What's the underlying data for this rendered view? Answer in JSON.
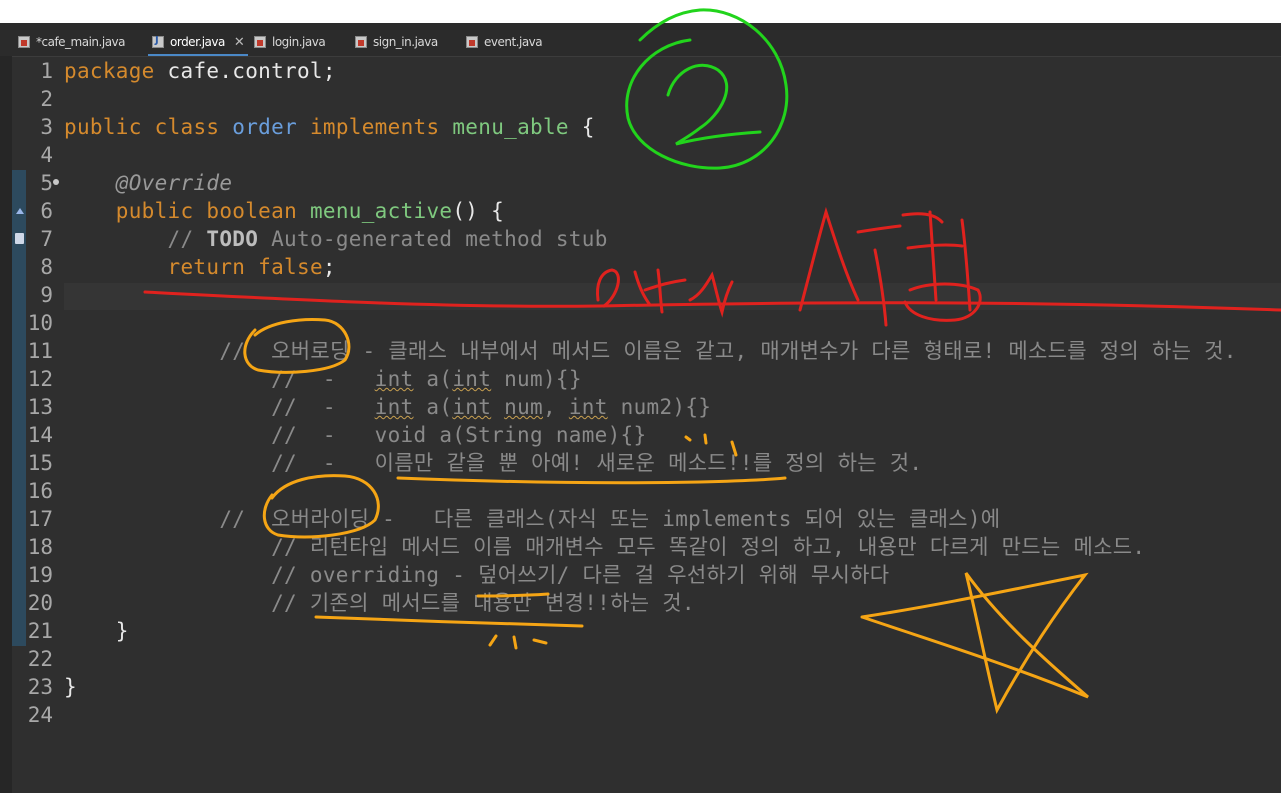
{
  "tabs": [
    {
      "label": "*cafe_main.java",
      "icon": "java-error-file-icon"
    },
    {
      "label": "order.java",
      "icon": "java-file-icon",
      "active": true
    },
    {
      "label": "login.java",
      "icon": "java-error-file-icon"
    },
    {
      "label": "sign_in.java",
      "icon": "java-error-file-icon"
    },
    {
      "label": "event.java",
      "icon": "java-error-file-icon"
    }
  ],
  "lines": [
    {
      "n": "1",
      "segments": [
        [
          "kw",
          "package"
        ],
        [
          "pl",
          " cafe.control;"
        ]
      ]
    },
    {
      "n": "2",
      "segments": []
    },
    {
      "n": "3",
      "segments": [
        [
          "kw",
          "public"
        ],
        [
          "pl",
          " "
        ],
        [
          "kw",
          "class"
        ],
        [
          "pl",
          " "
        ],
        [
          "ty",
          "order"
        ],
        [
          "pl",
          " "
        ],
        [
          "kw",
          "implements"
        ],
        [
          "pl",
          " "
        ],
        [
          "fn",
          "menu_able"
        ],
        [
          "pl",
          " {"
        ]
      ]
    },
    {
      "n": "4",
      "segments": []
    },
    {
      "n": "5",
      "segments": [
        [
          "pl",
          "    "
        ],
        [
          "an",
          "@Override"
        ]
      ]
    },
    {
      "n": "6",
      "segments": [
        [
          "pl",
          "    "
        ],
        [
          "kw",
          "public"
        ],
        [
          "pl",
          " "
        ],
        [
          "kw",
          "boolean"
        ],
        [
          "pl",
          " "
        ],
        [
          "fn",
          "menu_active"
        ],
        [
          "pl",
          "() {"
        ]
      ]
    },
    {
      "n": "7",
      "segments": [
        [
          "pl",
          "        "
        ],
        [
          "cm",
          "// "
        ],
        [
          "todo",
          "TODO"
        ],
        [
          "cm",
          " Auto-generated method stub"
        ]
      ]
    },
    {
      "n": "8",
      "segments": [
        [
          "pl",
          "        "
        ],
        [
          "kw",
          "return"
        ],
        [
          "pl",
          " "
        ],
        [
          "kw",
          "false"
        ],
        [
          "pl",
          ";"
        ]
      ]
    },
    {
      "n": "9",
      "segments": []
    },
    {
      "n": "10",
      "segments": []
    },
    {
      "n": "11",
      "segments": [
        [
          "pl",
          "            "
        ],
        [
          "cm",
          "//  오버로딩 - 클래스 내부에서 메서드 이름은 같고, 매개변수가 다른 형태로! 메소드를 정의 하는 것."
        ]
      ]
    },
    {
      "n": "12",
      "segments": [
        [
          "pl",
          "                "
        ],
        [
          "cm",
          "//  -   "
        ],
        [
          "cmsq",
          "int"
        ],
        [
          "cm",
          " a("
        ],
        [
          "cmsq",
          "int"
        ],
        [
          "cm",
          " num){}"
        ]
      ]
    },
    {
      "n": "13",
      "segments": [
        [
          "pl",
          "                "
        ],
        [
          "cm",
          "//  -   "
        ],
        [
          "cmsq",
          "int"
        ],
        [
          "cm",
          " a("
        ],
        [
          "cmsq",
          "int"
        ],
        [
          "cm",
          " "
        ],
        [
          "cmsq",
          "num"
        ],
        [
          "cm",
          ", "
        ],
        [
          "cmsq",
          "int"
        ],
        [
          "cm",
          " num2){}"
        ]
      ]
    },
    {
      "n": "14",
      "segments": [
        [
          "pl",
          "                "
        ],
        [
          "cm",
          "//  -   void a(String name){}"
        ]
      ]
    },
    {
      "n": "15",
      "segments": [
        [
          "pl",
          "                "
        ],
        [
          "cm",
          "//  -   이름만 같을 뿐 아예! 새로운 메소드!!를 정의 하는 것."
        ]
      ]
    },
    {
      "n": "16",
      "segments": []
    },
    {
      "n": "17",
      "segments": [
        [
          "pl",
          "            "
        ],
        [
          "cm",
          "//  오버라이딩 -   다른 클래스(자식 또는 implements 되어 있는 클래스)에"
        ]
      ]
    },
    {
      "n": "18",
      "segments": [
        [
          "pl",
          "                "
        ],
        [
          "cm",
          "// 리턴타입 메서드 이름 매개변수 모두 똑같이 정의 하고, 내용만 다르게 만드는 메소드."
        ]
      ]
    },
    {
      "n": "19",
      "segments": [
        [
          "pl",
          "                "
        ],
        [
          "cm",
          "// overriding - 덮어쓰기/ 다른 걸 우선하기 위해 무시하다"
        ]
      ]
    },
    {
      "n": "20",
      "segments": [
        [
          "pl",
          "                "
        ],
        [
          "cm",
          "// 기존의 메서드를 내용만 변경!!하는 것."
        ]
      ]
    },
    {
      "n": "21",
      "segments": [
        [
          "pl",
          "    }"
        ]
      ]
    },
    {
      "n": "22",
      "segments": []
    },
    {
      "n": "23",
      "segments": [
        [
          "pl",
          "}"
        ]
      ]
    },
    {
      "n": "24",
      "segments": []
    }
  ],
  "colors": {
    "keyword": "#d58a2d",
    "type": "#6a9edc",
    "method": "#7fc97f",
    "comment": "#8a8a8a",
    "ink_green": "#22d41c",
    "ink_red": "#e0221e",
    "ink_orange": "#f5a515"
  }
}
